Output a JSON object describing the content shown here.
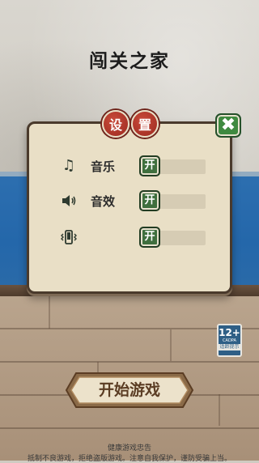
{
  "title": "闯关之家",
  "settings": {
    "heading_chars": [
      "设",
      "置"
    ],
    "close_symbol": "✖",
    "rows": [
      {
        "icon": "music-note-icon",
        "glyph": "♫",
        "label": "音乐",
        "toggle_label": "开",
        "state": "on"
      },
      {
        "icon": "speaker-icon",
        "glyph": "🔈",
        "label": "音效",
        "toggle_label": "开",
        "state": "on"
      },
      {
        "icon": "vibrate-icon",
        "glyph": "📳",
        "label": "",
        "toggle_label": "开",
        "state": "on"
      }
    ]
  },
  "age_rating": {
    "number": "12+",
    "org": "CADPA",
    "tip": "适龄提示"
  },
  "start_button": {
    "label": "开始游戏"
  },
  "notice": {
    "title": "健康游戏忠告",
    "line1": "抵制不良游戏，拒绝盗版游戏。注意自我保护，谨防受骗上当。"
  },
  "colors": {
    "panel": "#e9dfc6",
    "heading_red": "#b23a2c",
    "toggle_green": "#3f6f3e",
    "close_green": "#3f8a40"
  }
}
